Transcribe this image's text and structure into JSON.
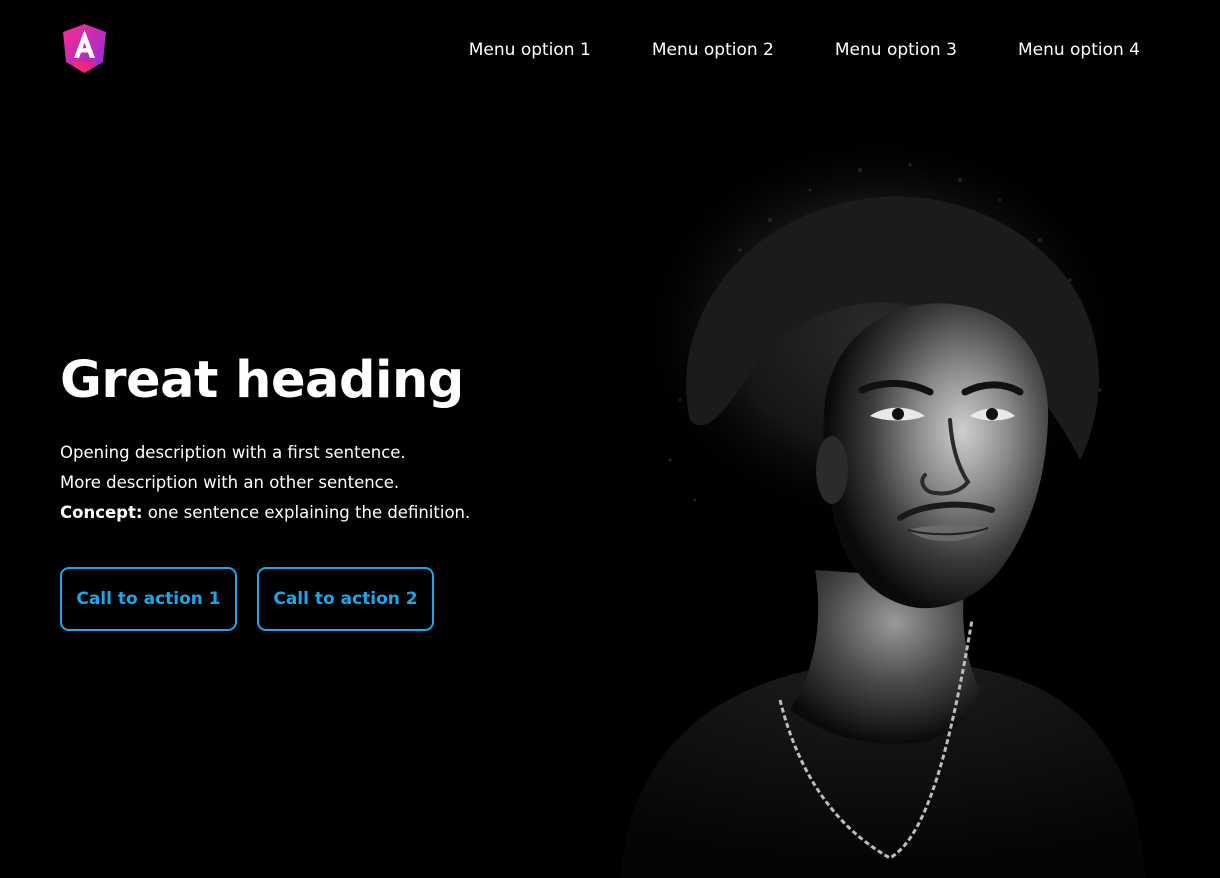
{
  "header": {
    "logo_icon": "angular-a-logo-icon",
    "nav": [
      {
        "label": "Menu option 1"
      },
      {
        "label": "Menu option 2"
      },
      {
        "label": "Menu option 3"
      },
      {
        "label": "Menu option 4"
      }
    ]
  },
  "hero": {
    "heading": "Great heading",
    "description": {
      "line1": "Opening description with a first sentence.",
      "line2": "More description with an other sentence.",
      "concept_label": "Concept:",
      "concept_text": " one sentence explaining the definition."
    },
    "cta_primary": "Call to action 1",
    "cta_secondary": "Call to action 2",
    "photo": "portrait-photo"
  },
  "colors": {
    "background": "#000000",
    "text": "#ffffff",
    "accent": "#1ea7e8",
    "logo_gradient_start": "#ff2d8a",
    "logo_gradient_end": "#7b2ff7"
  }
}
